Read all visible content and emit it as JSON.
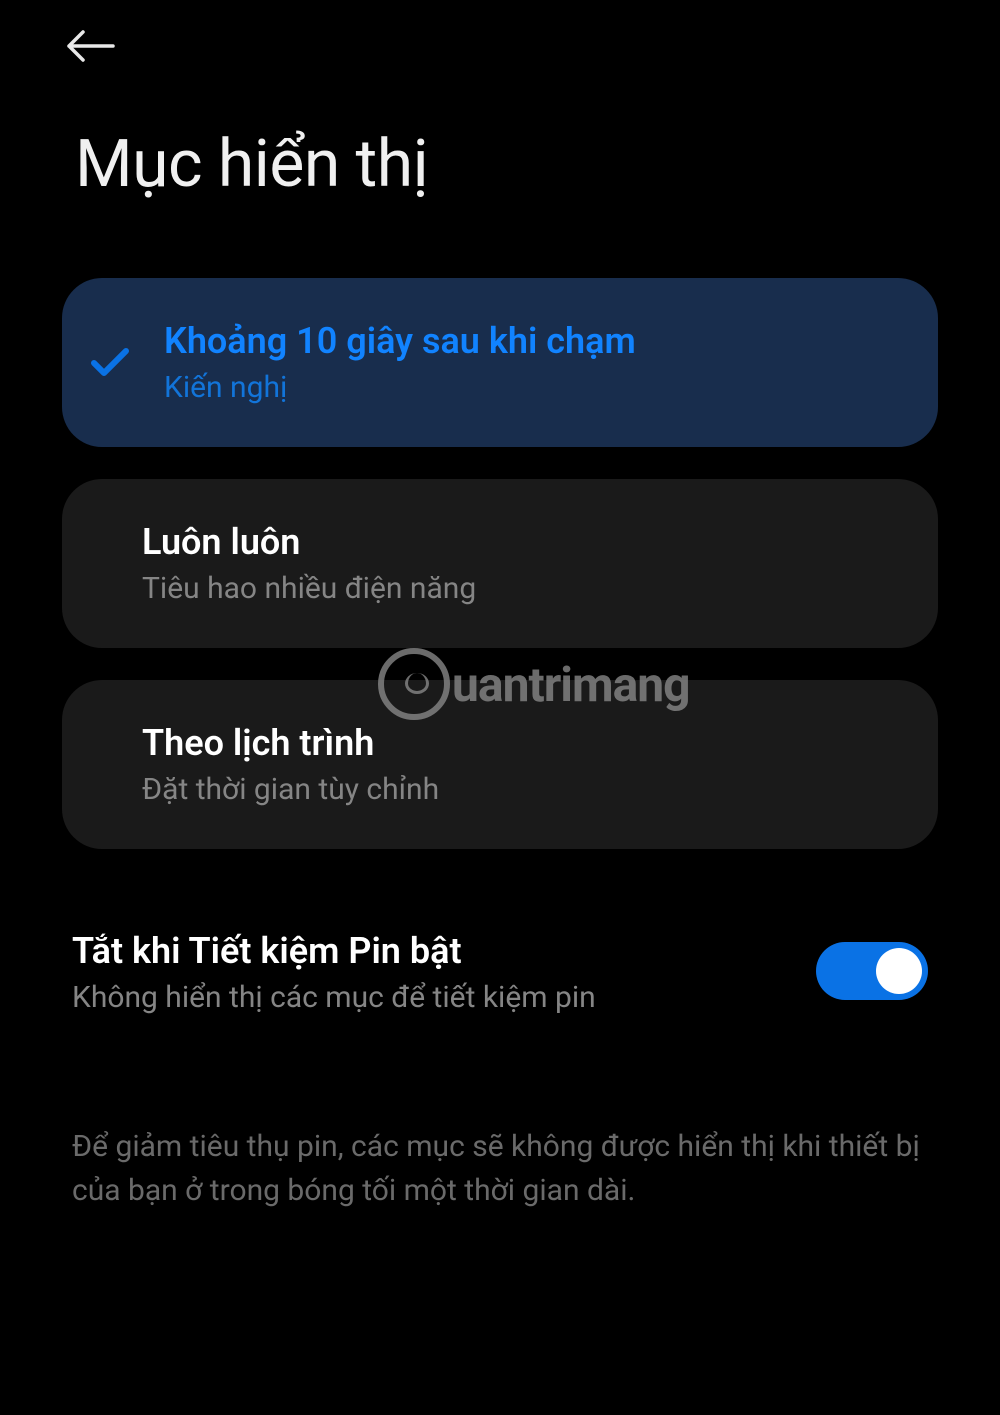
{
  "page": {
    "title": "Mục hiển thị"
  },
  "options": {
    "option1": {
      "title": "Khoảng 10 giây sau khi chạm",
      "subtitle": "Kiến nghị",
      "selected": true
    },
    "option2": {
      "title": "Luôn luôn",
      "subtitle": "Tiêu hao nhiều điện năng",
      "selected": false
    },
    "option3": {
      "title": "Theo lịch trình",
      "subtitle": "Đặt thời gian tùy chỉnh",
      "selected": false
    }
  },
  "toggle": {
    "title": "Tắt khi Tiết kiệm Pin bật",
    "subtitle": "Không hiển thị các mục để tiết kiệm pin",
    "enabled": true
  },
  "footer": {
    "text": "Để giảm tiêu thụ pin, các mục sẽ không được hiển thị khi thiết bị của bạn ở trong bóng tối một thời gian dài."
  },
  "watermark": {
    "text": "uantrimang"
  }
}
